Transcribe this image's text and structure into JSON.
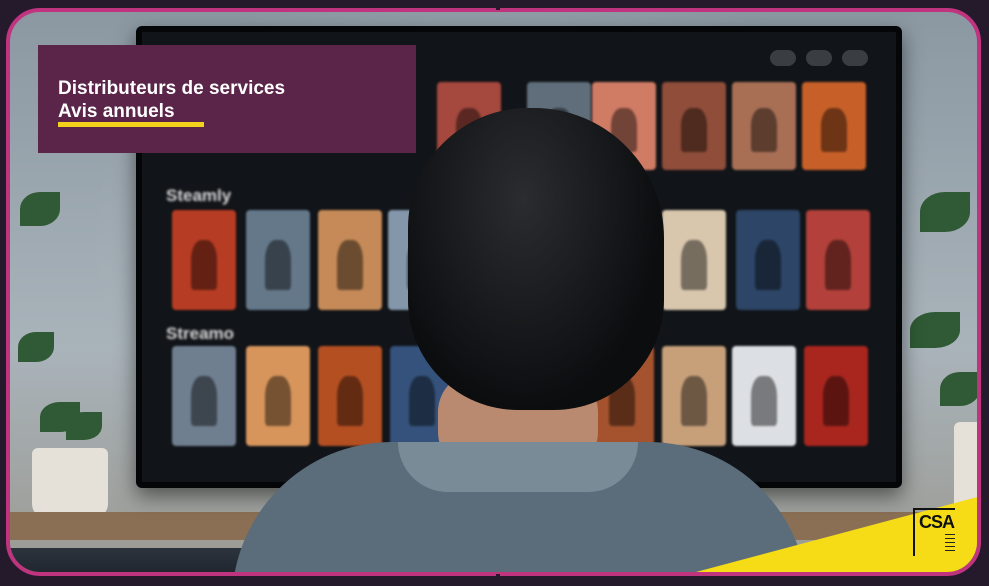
{
  "banner": {
    "line1": "Distributeurs de services",
    "line2": "Avis annuels",
    "box_color": "#5a2549",
    "underline_color": "#f2d21a"
  },
  "frame_color": "#c0337f",
  "tv": {
    "row1_label": "Steamly",
    "row2_label": "Streamo"
  },
  "logo": {
    "text": "CSA",
    "accent": "#f6dc16"
  },
  "scene_icons": [
    "tv-control-icon",
    "tv-control-icon",
    "tv-control-icon"
  ]
}
